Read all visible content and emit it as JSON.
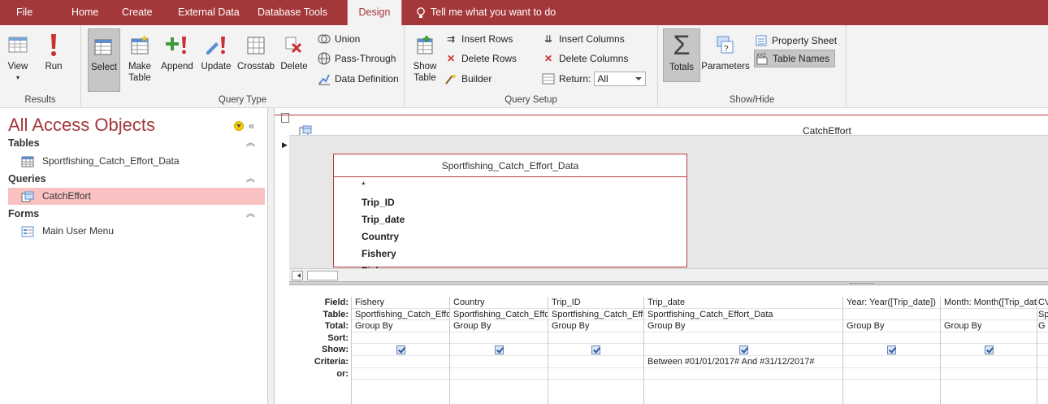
{
  "tabs": [
    "File",
    "Home",
    "Create",
    "External Data",
    "Database Tools",
    "Design"
  ],
  "active_tab": "Design",
  "tell_me": "Tell me what you want to do",
  "ribbon": {
    "results": {
      "label": "Results",
      "view": "View",
      "run": "Run"
    },
    "query_type": {
      "label": "Query Type",
      "select": "Select",
      "make_table_1": "Make",
      "make_table_2": "Table",
      "append": "Append",
      "update": "Update",
      "crosstab": "Crosstab",
      "delete": "Delete",
      "union": "Union",
      "pass_through": "Pass-Through",
      "data_definition": "Data Definition"
    },
    "query_setup": {
      "label": "Query Setup",
      "show_table_1": "Show",
      "show_table_2": "Table",
      "insert_rows": "Insert Rows",
      "delete_rows": "Delete Rows",
      "builder": "Builder",
      "insert_columns": "Insert Columns",
      "delete_columns": "Delete Columns",
      "return_label": "Return:",
      "return_value": "All"
    },
    "show_hide": {
      "label": "Show/Hide",
      "totals": "Totals",
      "parameters": "Parameters",
      "property_sheet": "Property Sheet",
      "table_names": "Table Names"
    }
  },
  "nav": {
    "title": "All Access Objects",
    "sections": [
      {
        "name": "Tables",
        "items": [
          "Sportfishing_Catch_Effort_Data"
        ]
      },
      {
        "name": "Queries",
        "items": [
          "CatchEffort"
        ]
      },
      {
        "name": "Forms",
        "items": [
          "Main User Menu"
        ]
      }
    ]
  },
  "query": {
    "title": "CatchEffort",
    "table_name": "Sportfishing_Catch_Effort_Data",
    "fields": [
      "*",
      "Trip_ID",
      "Trip_date",
      "Country",
      "Fishery",
      "Fisher_name"
    ],
    "row_labels": [
      "Field:",
      "Table:",
      "Total:",
      "Sort:",
      "Show:",
      "Criteria:",
      "or:"
    ],
    "columns": [
      {
        "field": "Fishery",
        "table": "Sportfishing_Catch_Effort_Data",
        "total": "Group By",
        "criteria": ""
      },
      {
        "field": "Country",
        "table": "Sportfishing_Catch_Effort_Data",
        "total": "Group By",
        "criteria": ""
      },
      {
        "field": "Trip_ID",
        "table": "Sportfishing_Catch_Effort_Data",
        "total": "Group By",
        "criteria": ""
      },
      {
        "field": "Trip_date",
        "table": "Sportfishing_Catch_Effort_Data",
        "total": "Group By",
        "criteria": "Between #01/01/2017# And #31/12/2017#"
      },
      {
        "field": "Year: Year([Trip_date])",
        "table": "",
        "total": "Group By",
        "criteria": ""
      },
      {
        "field": "Month: Month([Trip_date])",
        "table": "",
        "total": "Group By",
        "criteria": ""
      },
      {
        "field": "CV",
        "table": "Sp",
        "total": "G",
        "criteria": ""
      }
    ]
  },
  "colors": {
    "accent": "#a4373a",
    "ribbon_bg": "#f3f3f3",
    "selected_nav": "#f9c1c1"
  }
}
